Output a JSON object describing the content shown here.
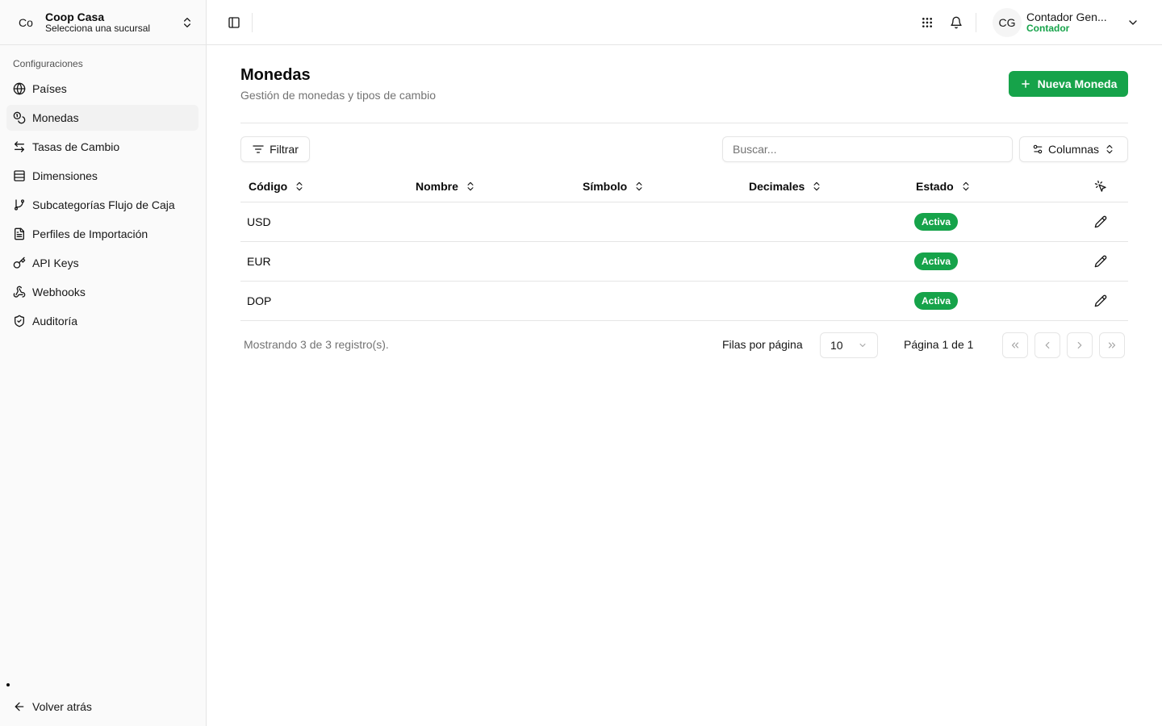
{
  "org": {
    "avatar": "Co",
    "name": "Coop Casa",
    "subtitle": "Selecciona una sucursal"
  },
  "sidebar": {
    "group_label": "Configuraciones",
    "items": [
      {
        "label": "Países",
        "icon": "globe-icon",
        "active": false
      },
      {
        "label": "Monedas",
        "icon": "coins-icon",
        "active": true
      },
      {
        "label": "Tasas de Cambio",
        "icon": "arrow-left-right-icon",
        "active": false
      },
      {
        "label": "Dimensiones",
        "icon": "table-icon",
        "active": false
      },
      {
        "label": "Subcategorías Flujo de Caja",
        "icon": "git-branch-icon",
        "active": false
      },
      {
        "label": "Perfiles de Importación",
        "icon": "file-text-icon",
        "active": false
      },
      {
        "label": "API Keys",
        "icon": "key-icon",
        "active": false
      },
      {
        "label": "Webhooks",
        "icon": "webhook-icon",
        "active": false
      },
      {
        "label": "Auditoría",
        "icon": "shield-icon",
        "active": false
      }
    ],
    "back_label": "Volver atrás"
  },
  "header": {
    "user_initials": "CG",
    "user_name": "Contador Gen...",
    "user_role": "Contador"
  },
  "page": {
    "title": "Monedas",
    "subtitle": "Gestión de monedas y tipos de cambio",
    "new_button": "Nueva Moneda"
  },
  "toolbar": {
    "filter_label": "Filtrar",
    "search_placeholder": "Buscar...",
    "columns_label": "Columnas"
  },
  "table": {
    "columns": [
      "Código",
      "Nombre",
      "Símbolo",
      "Decimales",
      "Estado"
    ],
    "rows": [
      {
        "code": "USD",
        "status": "Activa"
      },
      {
        "code": "EUR",
        "status": "Activa"
      },
      {
        "code": "DOP",
        "status": "Activa"
      }
    ]
  },
  "pagination": {
    "showing": "Mostrando 3 de 3 registro(s).",
    "rows_per_page_label": "Filas por página",
    "rows_per_page": "10",
    "page_info": "Página 1 de 1"
  },
  "colors": {
    "accent": "#16a34a",
    "border": "#e5e5e5",
    "muted": "#737373",
    "sidebar_bg": "#fafafa"
  }
}
